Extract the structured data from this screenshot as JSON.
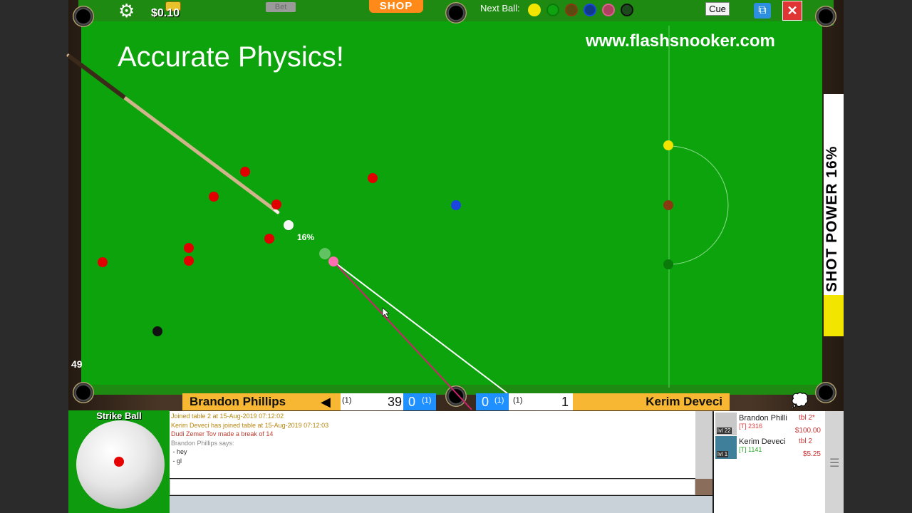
{
  "header": {
    "money": "$0.10",
    "bet_label": "Bet",
    "shop_label": "SHOP",
    "next_ball_label": "Next Ball:",
    "next_balls": [
      "yellow",
      "green",
      "brown",
      "blue",
      "pink",
      "black"
    ],
    "cue_label": "Cue"
  },
  "overlay": {
    "title": "Accurate Physics!",
    "url": "www.flashsnooker.com"
  },
  "table": {
    "shot_percent": "16%",
    "counter": "49"
  },
  "power": {
    "label": "SHOT POWER 16%",
    "level_percent": 16
  },
  "score": {
    "player1": {
      "name": "Brandon Phillips",
      "frames_label": "(1)",
      "score": "39",
      "frames": "0",
      "frames_sub": "(1)"
    },
    "player2": {
      "name": "Kerim Deveci",
      "frames": "0",
      "frames_sub": "(1)",
      "frames_label": "(1)",
      "score": "1"
    },
    "turn_indicator": "◀"
  },
  "strike": {
    "title": "Strike Ball"
  },
  "chat": {
    "lines": [
      {
        "text": "Joined table 2 at 15-Aug-2019 07:12:02",
        "color": "#b8860b"
      },
      {
        "text": "Kerim Deveci has joined table at 15-Aug-2019 07:12:03",
        "color": "#b8860b"
      },
      {
        "text": "Dudi Zemer Tov made a break of 14",
        "color": "#c0392b"
      },
      {
        "text": "Brandon Phillips says:",
        "color": "#888888"
      },
      {
        "text": " - hey",
        "color": "#333333"
      },
      {
        "text": " - gl",
        "color": "#333333"
      }
    ]
  },
  "players": [
    {
      "name": "Brandon Philli",
      "rank": "[T] 2316",
      "table": "tbl 2*",
      "money": "$100.00",
      "level": "lvl 22",
      "rank_color": "#e04040"
    },
    {
      "name": "Kerim Deveci",
      "rank": "[T] 1141",
      "table": "tbl 2",
      "money": "$5.25",
      "level": "lvl 1",
      "rank_color": "#2aa52a"
    }
  ]
}
